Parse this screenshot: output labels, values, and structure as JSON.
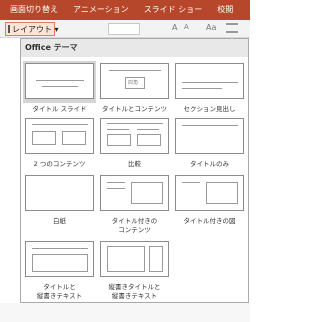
{
  "ribbon": {
    "tabs": [
      "画面切り替え",
      "アニメーション",
      "スライド ショー",
      "校閲"
    ]
  },
  "toolbar": {
    "layout_label": "レイアウト ▾",
    "grow_font": "A",
    "shrink_font": "A",
    "aa_icon": "Aa"
  },
  "gallery": {
    "header": "Office テーマ",
    "placeholder_text": "四角",
    "layouts": [
      {
        "label": "タイトル スライド"
      },
      {
        "label": "タイトルとコンテンツ"
      },
      {
        "label": "セクション見出し"
      },
      {
        "label": "2 つのコンテンツ"
      },
      {
        "label": "比較"
      },
      {
        "label": "タイトルのみ"
      },
      {
        "label": "白紙"
      },
      {
        "label_line1": "タイトル付きの",
        "label_line2": "コンテンツ"
      },
      {
        "label": "タイトル付きの図"
      },
      {
        "label_line1": "タイトルと",
        "label_line2": "縦書きテキスト"
      },
      {
        "label_line1": "縦書きタイトルと",
        "label_line2": "縦書きテキスト"
      }
    ]
  }
}
